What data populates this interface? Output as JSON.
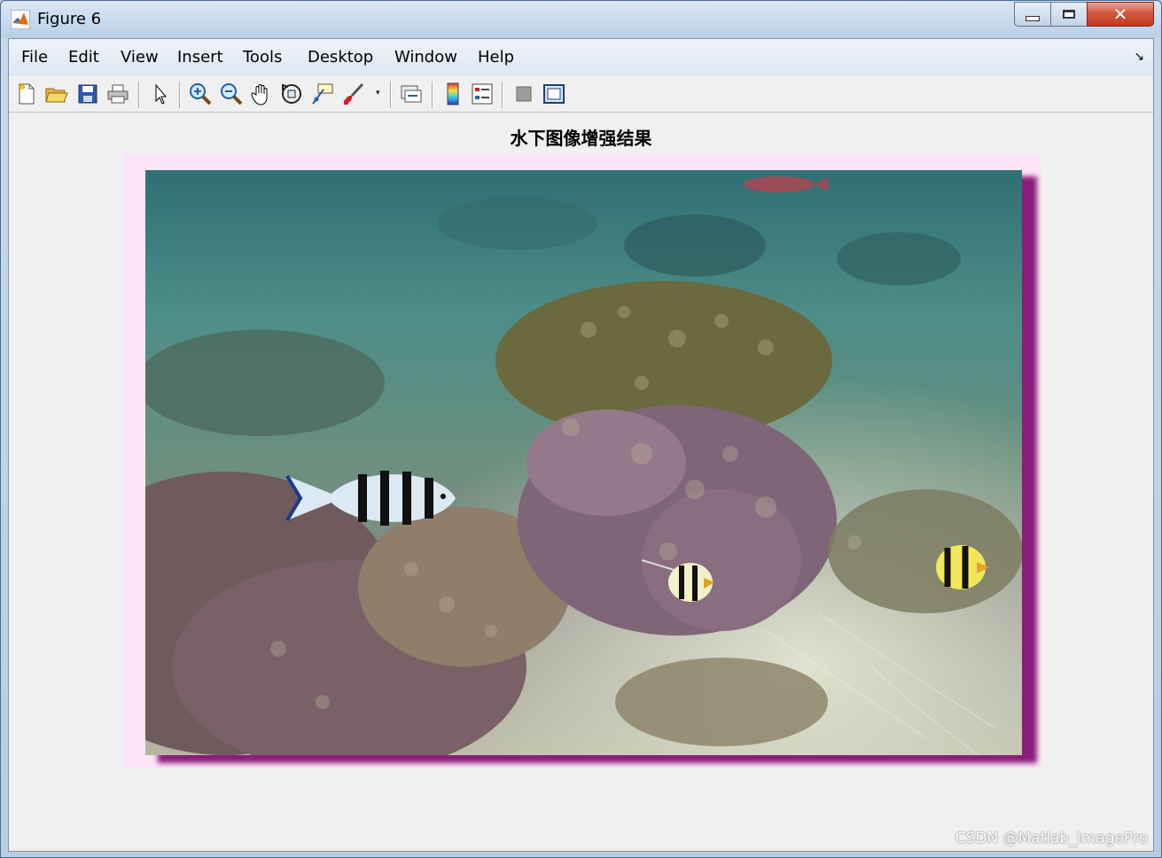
{
  "window": {
    "title": "Figure 6",
    "close_glyph": "✕"
  },
  "menubar": {
    "items": [
      "File",
      "Edit",
      "View",
      "Insert",
      "Tools",
      "Desktop",
      "Window",
      "Help"
    ],
    "dock_arrow": "↘"
  },
  "toolbar": {
    "icons": [
      "new-figure-icon",
      "open-file-icon",
      "save-icon",
      "print-icon",
      "edit-plot-arrow-icon",
      "zoom-in-icon",
      "zoom-out-icon",
      "pan-hand-icon",
      "rotate-3d-icon",
      "data-cursor-icon",
      "brush-icon",
      "link-plot-icon",
      "insert-colorbar-icon",
      "insert-legend-icon",
      "hide-plot-tools-icon",
      "show-plot-tools-icon"
    ],
    "dropdown_glyph": "▾"
  },
  "axes": {
    "title": "水下图像增强结果"
  },
  "watermark": "CSDN @Matlab_ImagePro",
  "colors": {
    "frame_pink": "#fbe4f7",
    "shadow_magenta": "#8a1d78",
    "title_bar": "#c9dbee",
    "close_red": "#c23a1f"
  }
}
